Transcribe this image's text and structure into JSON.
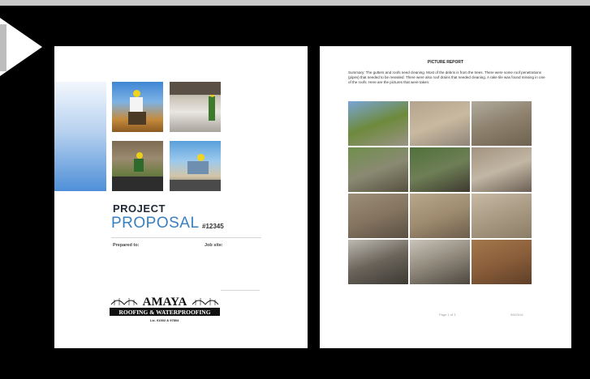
{
  "cover": {
    "title_line1": "PROJECT",
    "title_line2": "PROPOSAL",
    "job_number": "#12345",
    "prepared_to_label": "Prepared to:",
    "job_site_label": "Job site:",
    "logo_text_top": "AMAYA",
    "logo_text_bottom": "ROOFING & WATERPROOFING",
    "license": "Lic. 01002 & 97804",
    "colors": {
      "accent": "#3a7fc1",
      "bar_top": "#f2f7fd",
      "bar_bottom": "#4f8fd8"
    }
  },
  "report": {
    "title": "PICTURE REPORT",
    "summary": "Summary: The gutters and roofs need cleaning.  Most of the debris is from the trees.  There were some roof penetrations (pipes) that needed to be resealed.  There were also roof drains that needed cleaning. A rake tile was found missing in one of the roofs.  Here are the pictures that were taken:",
    "page_label": "Page 1 of 3",
    "date": "9/6/2016",
    "photos": [
      {
        "name": "palm-trees-driveway-photo",
        "c1": "#7aa5d6",
        "c2": "#6d8a3c",
        "c3": "#9a9386"
      },
      {
        "name": "house-wall-photo",
        "c1": "#b3a48e",
        "c2": "#c9b9a0",
        "c3": "#8f8578"
      },
      {
        "name": "building-corner-photo",
        "c1": "#b0ab9e",
        "c2": "#8d806c",
        "c3": "#6e6350"
      },
      {
        "name": "tree-yard-photo",
        "c1": "#6f8f4c",
        "c2": "#8a8a72",
        "c3": "#55503f"
      },
      {
        "name": "trees-roof-edge-photo",
        "c1": "#50713a",
        "c2": "#6e7f56",
        "c3": "#3f3a2f"
      },
      {
        "name": "tile-roof-closeup-photo",
        "c1": "#a1937f",
        "c2": "#c2b6a4",
        "c3": "#6b6054"
      },
      {
        "name": "gutter-debris-photo",
        "c1": "#9c8e78",
        "c2": "#857560",
        "c3": "#5a4f43"
      },
      {
        "name": "roof-tiles-gutter-photo",
        "c1": "#b8a78b",
        "c2": "#9f8c70",
        "c3": "#6d5e4c"
      },
      {
        "name": "roof-pipe-photo",
        "c1": "#c7b9a4",
        "c2": "#a99a84",
        "c3": "#8c7d66"
      },
      {
        "name": "roof-drain-photo",
        "c1": "#bdbab2",
        "c2": "#6a645a",
        "c3": "#3c3934"
      },
      {
        "name": "rooftop-equipment-photo",
        "c1": "#c9c4ba",
        "c2": "#8f877a",
        "c3": "#4d473f"
      },
      {
        "name": "missing-rake-tile-photo",
        "c1": "#a4774c",
        "c2": "#8a5e3a",
        "c3": "#5e3f28"
      }
    ]
  }
}
